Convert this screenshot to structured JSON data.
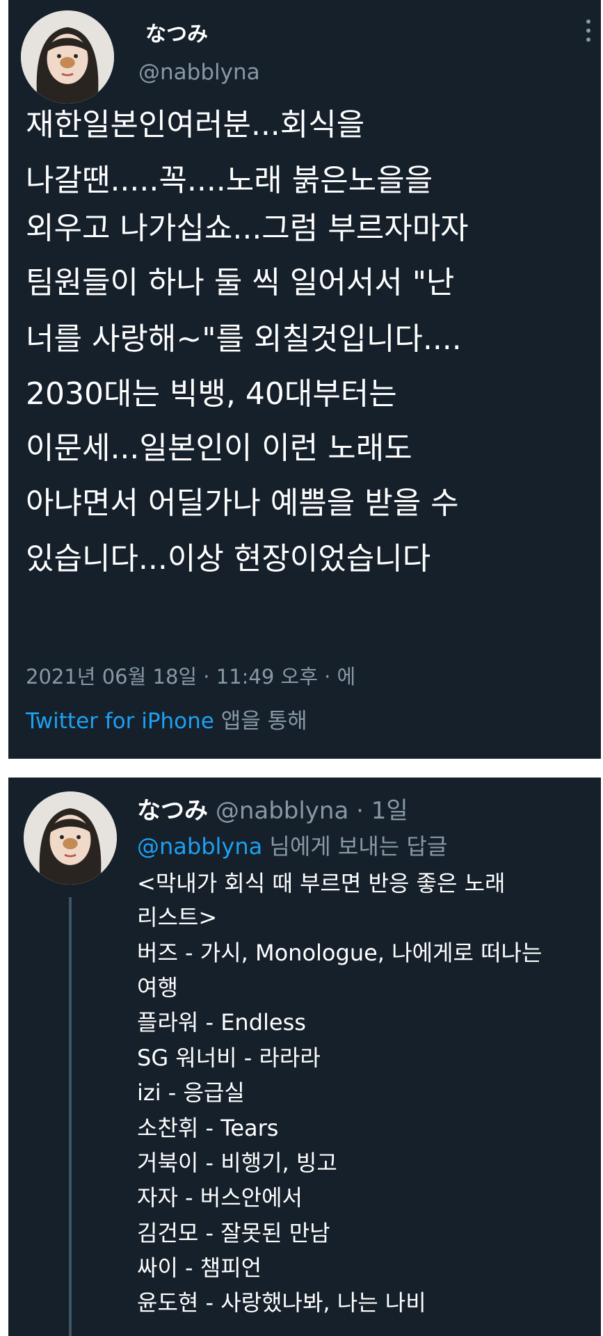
{
  "tweet": {
    "display_name": "なつみ",
    "handle": "@nabblyna",
    "body_lines": [
      "재한일본인여러분...회식을",
      "나갈땐.....꼭....노래 붉은노을을",
      "외우고 나가십쇼...그럼 부르자마자",
      "팀원들이 하나 둘 씩  일어서서 \"난",
      "너를 사랑해~\"를 외칠것입니다....",
      "2030대는 빅뱅, 40대부터는",
      "이문세...일본인이 이런 노래도",
      "아냐면서 어딜가나 예쁨을 받을 수",
      "있습니다...이상 현장이었습니다"
    ],
    "timestamp": "2021년 06월 18일 · 11:49 오후 · 에",
    "source_app": "Twitter for iPhone",
    "source_suffix": " 앱을 통해",
    "more_icon": "more-vertical-icon"
  },
  "reply": {
    "display_name": "なつみ",
    "handle": "@nabblyna",
    "time": "· 1일",
    "replying_to": "@nabblyna",
    "replying_suffix": " 님에게 보내는 답글",
    "body_lines": [
      "<막내가 회식 때 부르면 반응 좋은 노래",
      "리스트>",
      "버즈 - 가시, Monologue, 나에게로 떠나는",
      "여행",
      "플라워 - Endless",
      "SG 워너비 - 라라라",
      "izi - 응급실",
      "소찬휘 - Tears",
      "거북이 - 비행기, 빙고",
      "자자 - 버스안에서",
      "김건모 - 잘못된 만남",
      "싸이 - 챔피언",
      "윤도현 - 사랑했나봐, 나는 나비"
    ]
  },
  "colors": {
    "background": "#15202b",
    "text": "#ffffff",
    "muted": "#8899a6",
    "link": "#1da1f2"
  }
}
